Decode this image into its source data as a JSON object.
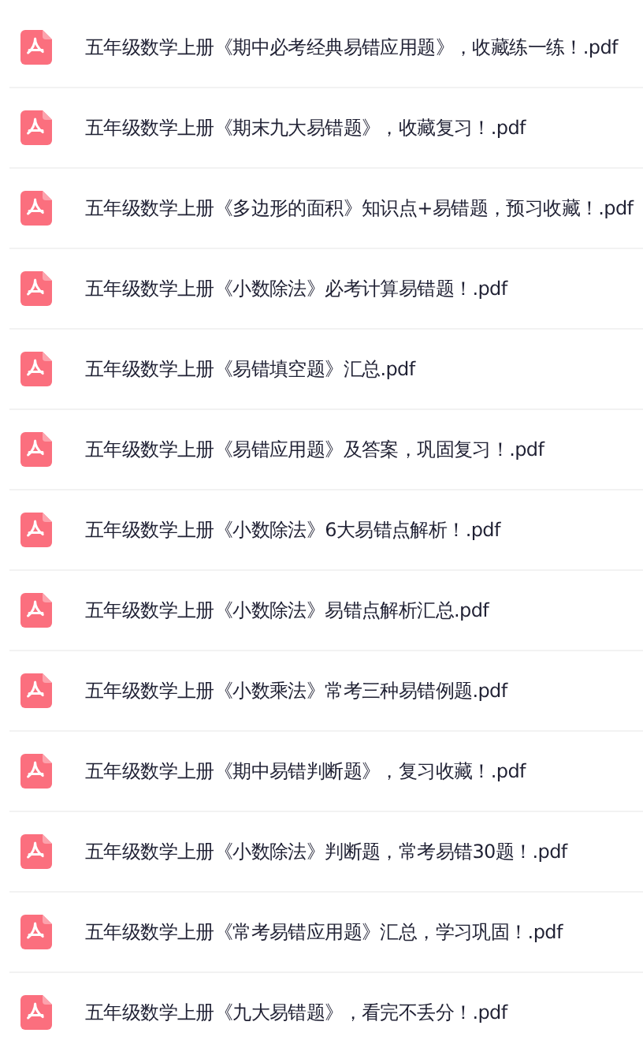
{
  "files": [
    {
      "name": "五年级数学上册《期中必考经典易错应用题》，收藏练一练！.pdf"
    },
    {
      "name": "五年级数学上册《期末九大易错题》，收藏复习！.pdf"
    },
    {
      "name": "五年级数学上册《多边形的面积》知识点+易错题，预习收藏！.pdf"
    },
    {
      "name": "五年级数学上册《小数除法》必考计算易错题！.pdf"
    },
    {
      "name": "五年级数学上册《易错填空题》汇总.pdf"
    },
    {
      "name": "五年级数学上册《易错应用题》及答案，巩固复习！.pdf"
    },
    {
      "name": "五年级数学上册《小数除法》6大易错点解析！.pdf"
    },
    {
      "name": "五年级数学上册《小数除法》易错点解析汇总.pdf"
    },
    {
      "name": "五年级数学上册《小数乘法》常考三种易错例题.pdf"
    },
    {
      "name": "五年级数学上册《期中易错判断题》，复习收藏！.pdf"
    },
    {
      "name": "五年级数学上册《小数除法》判断题，常考易错30题！.pdf"
    },
    {
      "name": "五年级数学上册《常考易错应用题》汇总，学习巩固！.pdf"
    },
    {
      "name": "五年级数学上册《九大易错题》，看完不丢分！.pdf"
    }
  ]
}
